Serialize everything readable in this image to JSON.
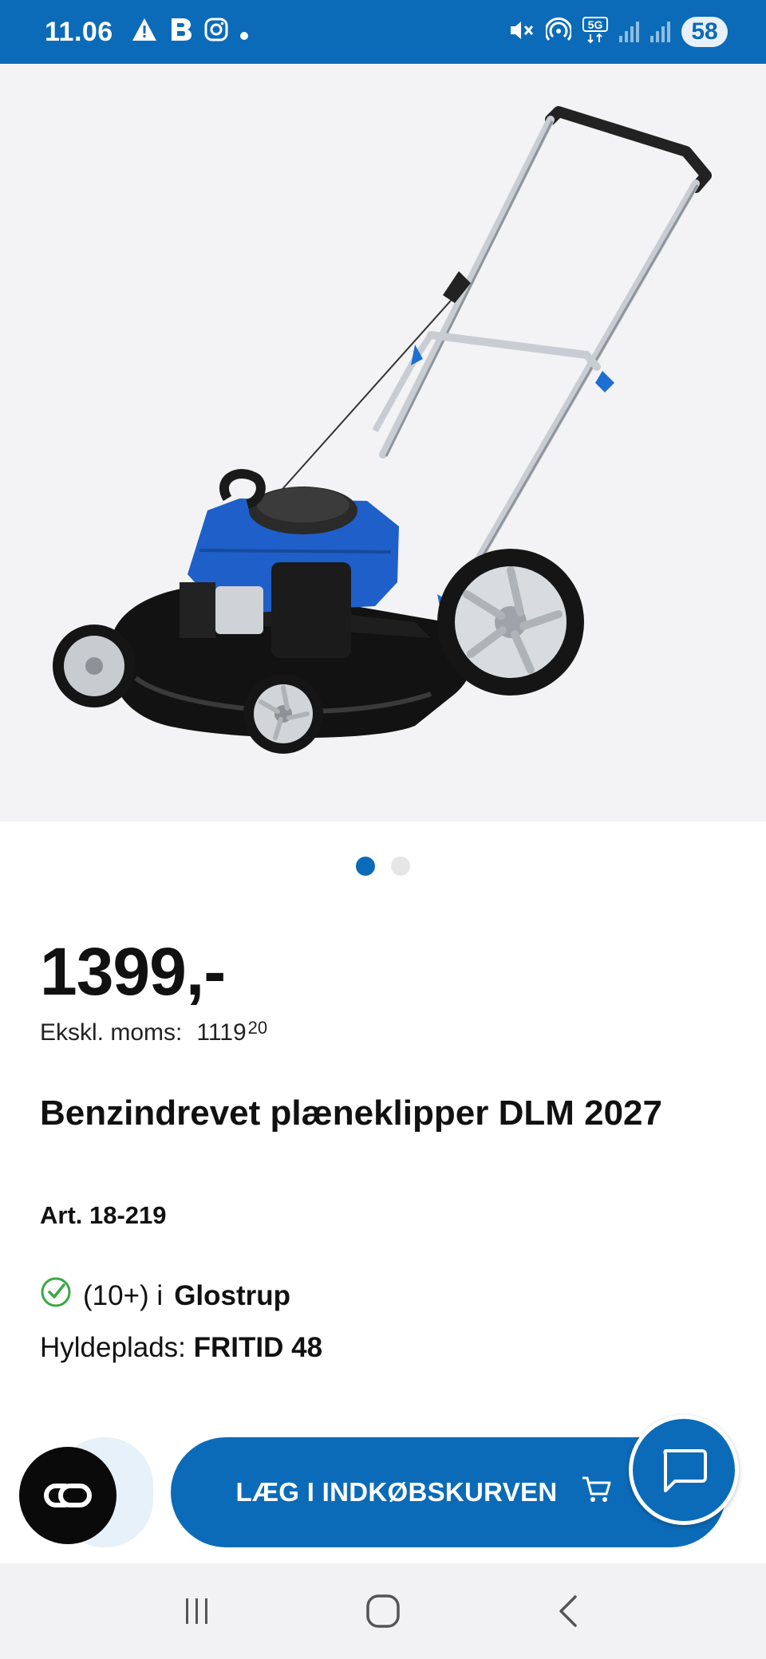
{
  "status_bar": {
    "time": "11.06",
    "icons": [
      "warning-icon",
      "b-app-icon",
      "instagram-icon",
      "dot-icon"
    ],
    "right_icons": [
      "mute-icon",
      "hotspot-icon",
      "5g-icon",
      "signal-icon",
      "signal-icon"
    ],
    "network_label": "5G",
    "battery": "58"
  },
  "product": {
    "image_alt": "Benzindrevet plæneklipper DLM 2027",
    "carousel": {
      "total": 2,
      "active": 1
    },
    "price": "1399,-",
    "excl_vat_label": "Ekskl. moms:",
    "excl_vat_main": "1119",
    "excl_vat_cents": "20",
    "title": "Benzindrevet plæneklipper DLM 2027",
    "article": "Art. 18-219",
    "stock_count": "(10+) i",
    "stock_store": "Glostrup",
    "shelf_label": "Hyldeplads:",
    "shelf_value": "FRITID 48"
  },
  "actions": {
    "co_label": "CO",
    "cart_label": "LÆG I INDKØBSKURVEN",
    "chat_icon": "chat-bubble-icon"
  },
  "nav": {
    "recent_icon": "recent-apps-icon",
    "home_icon": "home-icon",
    "back_icon": "back-icon"
  },
  "colors": {
    "brand_blue": "#0b6bb8",
    "check_green": "#3aa845"
  }
}
